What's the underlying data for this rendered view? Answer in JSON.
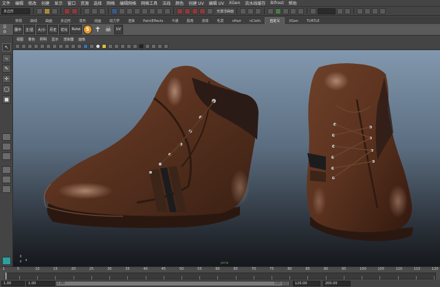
{
  "menubar": {
    "items": [
      "文件",
      "编辑",
      "修改",
      "创建",
      "显示",
      "窗口",
      "资源",
      "选择",
      "网格",
      "编辑网格",
      "网格工具",
      "法线",
      "颜色",
      "创建 UV",
      "编辑 UV",
      "XGen",
      "流水线缓存",
      "Bifrost",
      "帮助"
    ]
  },
  "statusline": {
    "mode": "多边形",
    "live_surface": "无激活曲面"
  },
  "shelf_tabs": {
    "items": [
      "常规",
      "曲线",
      "曲面",
      "多边形",
      "变形",
      "动画",
      "动力学",
      "渲染",
      "PaintEffects",
      "卡通",
      "肌肉",
      "流体",
      "毛发",
      "nHair",
      "nCloth",
      "自定义",
      "XGen",
      "TURTLE"
    ],
    "active_index": 15
  },
  "shelf": {
    "buttons": [
      "展中",
      "主/显",
      "大/小",
      "历史",
      "优化",
      "Rshd"
    ],
    "logo_letter": "5",
    "last_label": "UV"
  },
  "panel": {
    "menu": [
      "视图",
      "着色",
      "照明",
      "显示",
      "渲染器",
      "面板"
    ]
  },
  "viewport": {
    "camera_label": "persp",
    "axis": {
      "x": "x",
      "y": "y",
      "z": "z"
    }
  },
  "timeslider": {
    "ticks": [
      "1",
      "5",
      "10",
      "15",
      "20",
      "25",
      "30",
      "35",
      "40",
      "45",
      "50",
      "55",
      "60",
      "65",
      "70",
      "75",
      "80",
      "85",
      "90",
      "95",
      "100",
      "105",
      "110",
      "115",
      "120"
    ]
  },
  "rangeslider": {
    "start": "1.00",
    "start_inner": "1.00",
    "range_start": "1.00",
    "range_end": "120",
    "end": "120.00",
    "end_outer": "200.00"
  }
}
